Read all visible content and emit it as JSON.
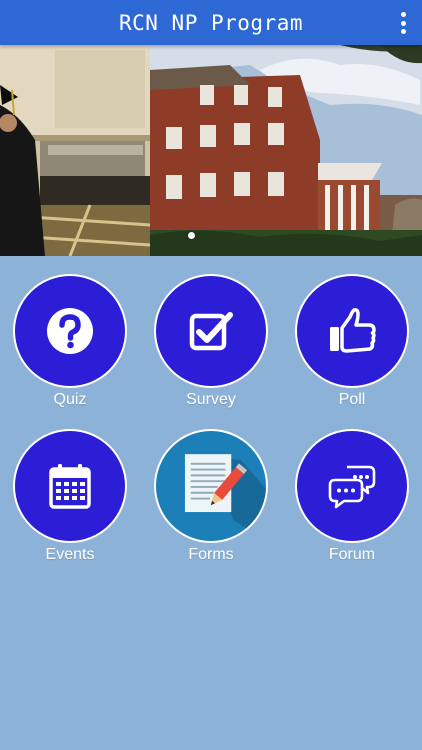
{
  "app": {
    "title": "RCN NP Program",
    "colors": {
      "appbar": "#2e68d4",
      "background": "#8cb2d8",
      "tile": "#2b1ed6",
      "forms_tile": "#1d7fb8"
    }
  },
  "header": {
    "menu_icon": "more-vert-icon"
  },
  "carousel": {
    "pages": 1,
    "active_page": 1
  },
  "tiles": [
    {
      "label": "Quiz",
      "icon": "question-icon"
    },
    {
      "label": "Survey",
      "icon": "checkbox-icon"
    },
    {
      "label": "Poll",
      "icon": "thumbs-up-icon"
    },
    {
      "label": "Events",
      "icon": "calendar-icon"
    },
    {
      "label": "Forms",
      "icon": "document-pencil-icon"
    },
    {
      "label": "Forum",
      "icon": "chat-bubbles-icon"
    }
  ]
}
